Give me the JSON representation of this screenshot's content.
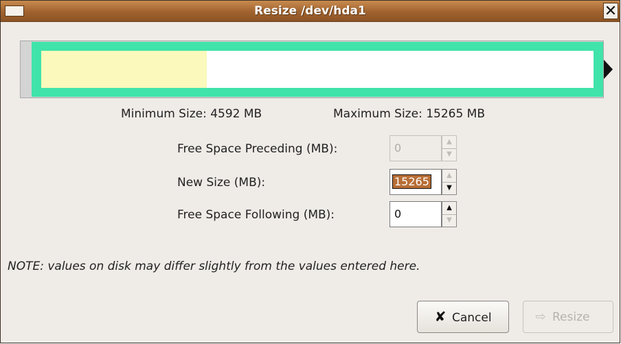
{
  "window": {
    "title": "Resize /dev/hda1",
    "menu_icon": "window-menu-icon",
    "close_icon": "close-icon",
    "close_glyph": "✕"
  },
  "partition": {
    "used_fraction": 0.3,
    "colors": {
      "frame": "#40e3aa",
      "used": "#fbf9bb",
      "free": "#ffffff"
    }
  },
  "sizes": {
    "minimum": "Minimum Size: 4592 MB",
    "maximum": "Maximum Size: 15265 MB"
  },
  "fields": {
    "preceding": {
      "label": "Free Space Preceding (MB):",
      "value": "0"
    },
    "new_size": {
      "label": "New Size (MB):",
      "value": "15265"
    },
    "following": {
      "label": "Free Space Following (MB):",
      "value": "0"
    }
  },
  "note": "NOTE: values on disk may differ slightly from the values entered here.",
  "buttons": {
    "cancel": {
      "label": "Cancel",
      "icon": "cancel-x-icon"
    },
    "resize": {
      "label": "Resize",
      "icon": "resize-arrow-icon"
    }
  },
  "accent_color": "#a0622e"
}
